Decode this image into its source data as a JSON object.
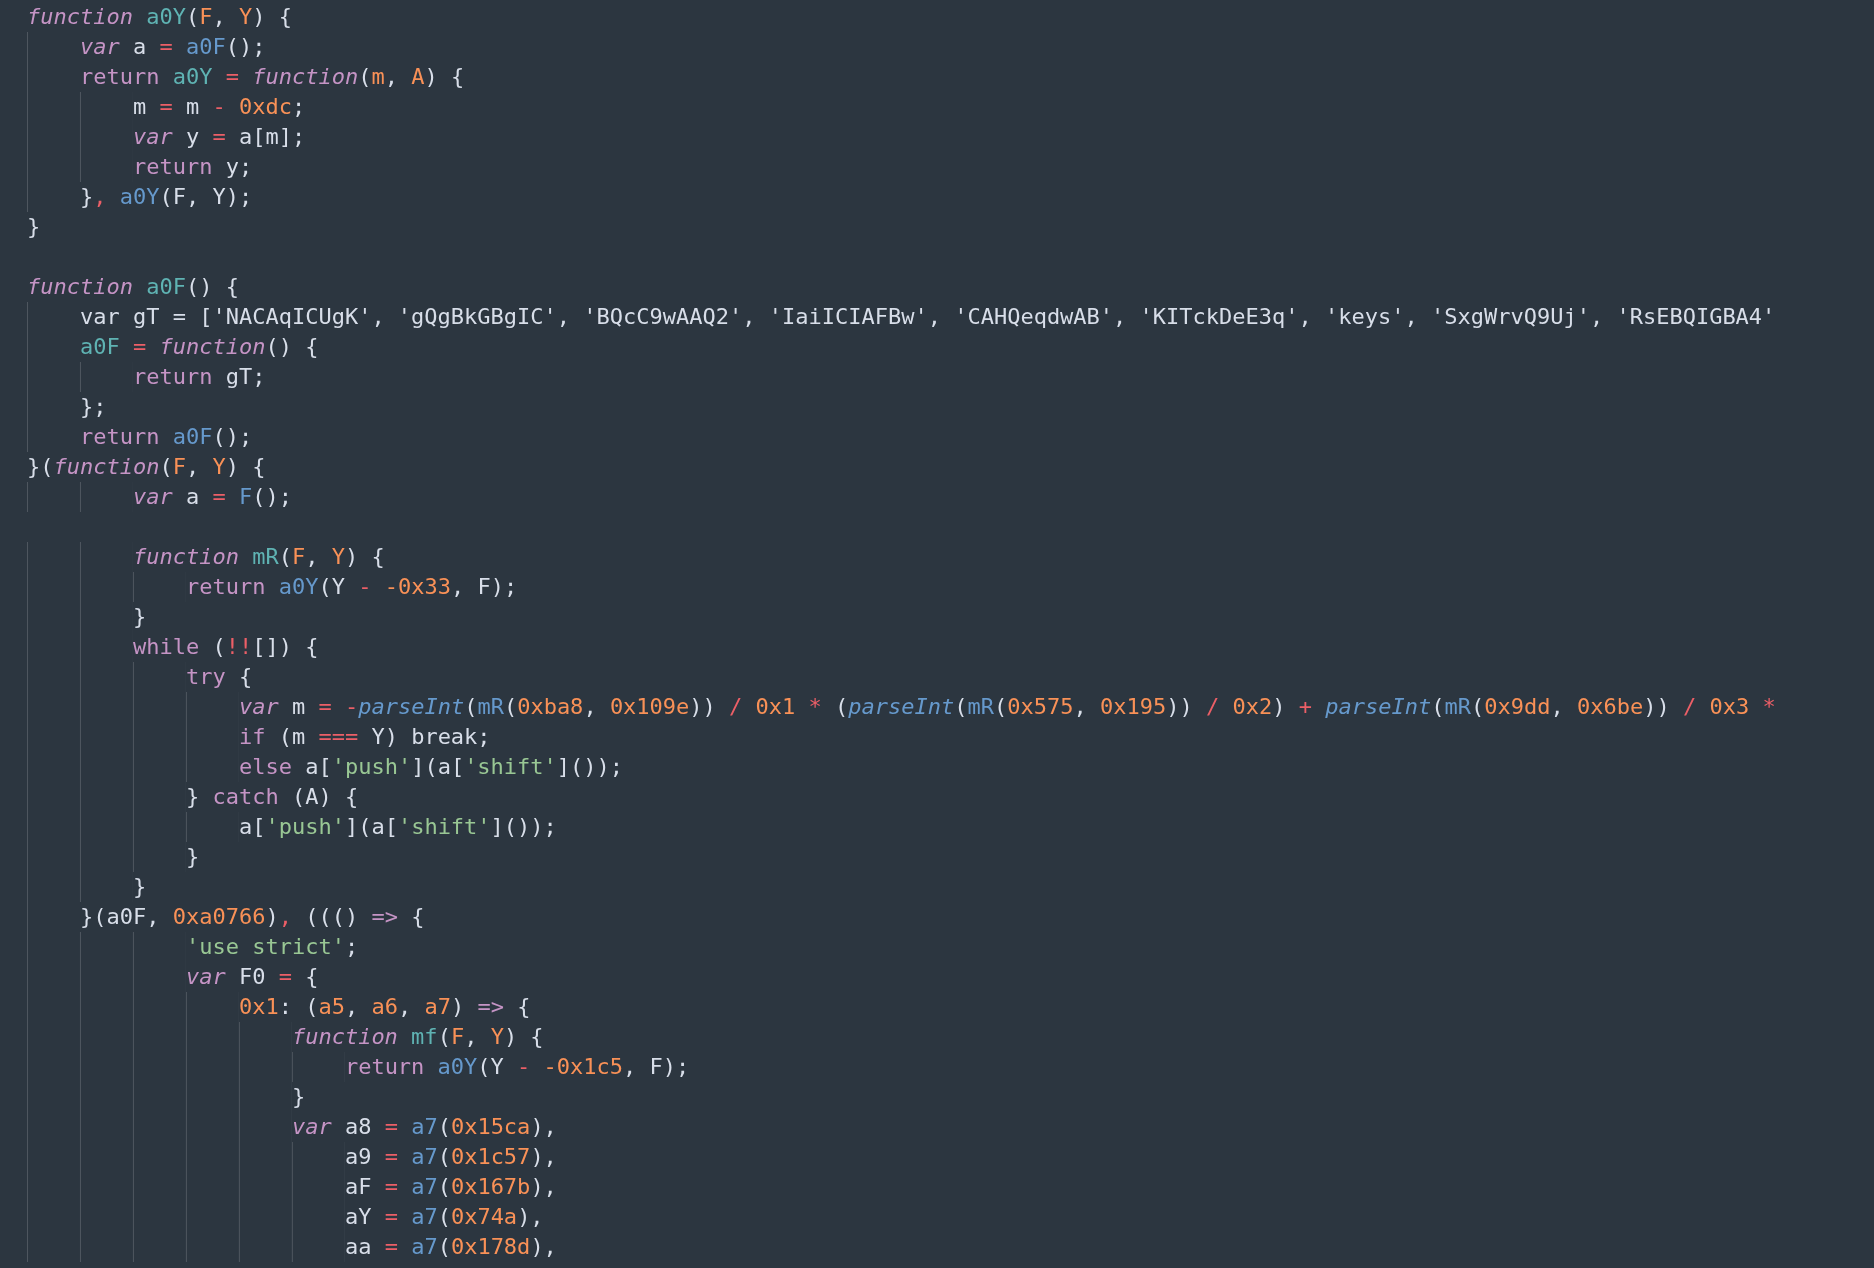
{
  "editor": {
    "lines": [
      {
        "kind": "code",
        "tokens": [
          {
            "kind": "keyword",
            "text": "function"
          },
          {
            "kind": "def",
            "text": " a0Y"
          },
          {
            "kind": "plain",
            "text": "("
          },
          {
            "kind": "param",
            "text": "F"
          },
          {
            "kind": "plain",
            "text": ", "
          },
          {
            "kind": "param",
            "text": "Y"
          },
          {
            "kind": "plain",
            "text": ") {"
          }
        ]
      },
      {
        "kind": "code",
        "tokens": [
          {
            "kind": "keyword",
            "text": "    var"
          },
          {
            "kind": "plain",
            "text": " a "
          },
          {
            "kind": "op",
            "text": "="
          },
          {
            "kind": "call",
            "text": " a0F"
          },
          {
            "kind": "plain",
            "text": "();"
          }
        ]
      },
      {
        "kind": "code",
        "tokens": [
          {
            "kind": "control",
            "text": "    return"
          },
          {
            "kind": "def",
            "text": " a0Y"
          },
          {
            "kind": "op",
            "text": " ="
          },
          {
            "kind": "keyword",
            "text": " function"
          },
          {
            "kind": "plain",
            "text": "("
          },
          {
            "kind": "param",
            "text": "m"
          },
          {
            "kind": "plain",
            "text": ", "
          },
          {
            "kind": "param",
            "text": "A"
          },
          {
            "kind": "plain",
            "text": ") {"
          }
        ]
      },
      {
        "kind": "code",
        "tokens": [
          {
            "kind": "plain",
            "text": "        m "
          },
          {
            "kind": "op",
            "text": "="
          },
          {
            "kind": "plain",
            "text": " m "
          },
          {
            "kind": "op",
            "text": "-"
          },
          {
            "kind": "number",
            "text": " 0xdc"
          },
          {
            "kind": "plain",
            "text": ";"
          }
        ]
      },
      {
        "kind": "code",
        "tokens": [
          {
            "kind": "keyword",
            "text": "        var"
          },
          {
            "kind": "plain",
            "text": " y "
          },
          {
            "kind": "op",
            "text": "="
          },
          {
            "kind": "plain",
            "text": " a[m];"
          }
        ]
      },
      {
        "kind": "code",
        "tokens": [
          {
            "kind": "control",
            "text": "        return"
          },
          {
            "kind": "plain",
            "text": " y;"
          }
        ]
      },
      {
        "kind": "code",
        "tokens": [
          {
            "kind": "plain",
            "text": "    }"
          },
          {
            "kind": "op",
            "text": ","
          },
          {
            "kind": "call",
            "text": " a0Y"
          },
          {
            "kind": "plain",
            "text": "(F, Y);"
          }
        ]
      },
      {
        "kind": "code",
        "tokens": [
          {
            "kind": "plain",
            "text": "}"
          }
        ]
      },
      {
        "kind": "blank"
      },
      {
        "kind": "code",
        "tokens": [
          {
            "kind": "keyword",
            "text": "function"
          },
          {
            "kind": "def",
            "text": " a0F"
          },
          {
            "kind": "plain",
            "text": "() {"
          }
        ]
      },
      {
        "kind": "code",
        "tokens": [
          {
            "kind": "plain",
            "text": "    var gT = ['NACAqICUgK', 'gQgBkGBgIC', 'BQcC9wAAQ2', 'IaiICIAFBw', 'CAHQeqdwAB', 'KITckDeE3q', 'keys', 'SxgWrvQ9Uj', 'RsEBQIGBA4'"
          }
        ]
      },
      {
        "kind": "code",
        "tokens": [
          {
            "kind": "def",
            "text": "    a0F"
          },
          {
            "kind": "op",
            "text": " ="
          },
          {
            "kind": "keyword",
            "text": " function"
          },
          {
            "kind": "plain",
            "text": "() {"
          }
        ]
      },
      {
        "kind": "code",
        "tokens": [
          {
            "kind": "control",
            "text": "        return"
          },
          {
            "kind": "plain",
            "text": " gT;"
          }
        ]
      },
      {
        "kind": "code",
        "tokens": [
          {
            "kind": "plain",
            "text": "    };"
          }
        ]
      },
      {
        "kind": "code",
        "tokens": [
          {
            "kind": "control",
            "text": "    return"
          },
          {
            "kind": "call",
            "text": " a0F"
          },
          {
            "kind": "plain",
            "text": "();"
          }
        ]
      },
      {
        "kind": "code",
        "tokens": [
          {
            "kind": "plain",
            "text": "}("
          },
          {
            "kind": "keyword",
            "text": "function"
          },
          {
            "kind": "plain",
            "text": "("
          },
          {
            "kind": "param",
            "text": "F"
          },
          {
            "kind": "plain",
            "text": ", "
          },
          {
            "kind": "param",
            "text": "Y"
          },
          {
            "kind": "plain",
            "text": ") {"
          }
        ]
      },
      {
        "kind": "code",
        "tokens": [
          {
            "kind": "keyword",
            "text": "        var"
          },
          {
            "kind": "plain",
            "text": " a "
          },
          {
            "kind": "op",
            "text": "="
          },
          {
            "kind": "call",
            "text": " F"
          },
          {
            "kind": "plain",
            "text": "();"
          }
        ]
      },
      {
        "kind": "blank"
      },
      {
        "kind": "code",
        "tokens": [
          {
            "kind": "keyword",
            "text": "        function"
          },
          {
            "kind": "def",
            "text": " mR"
          },
          {
            "kind": "plain",
            "text": "("
          },
          {
            "kind": "param",
            "text": "F"
          },
          {
            "kind": "plain",
            "text": ", "
          },
          {
            "kind": "param",
            "text": "Y"
          },
          {
            "kind": "plain",
            "text": ") {"
          }
        ]
      },
      {
        "kind": "code",
        "tokens": [
          {
            "kind": "control",
            "text": "            return"
          },
          {
            "kind": "call",
            "text": " a0Y"
          },
          {
            "kind": "plain",
            "text": "(Y "
          },
          {
            "kind": "op",
            "text": "-"
          },
          {
            "kind": "number",
            "text": " -0x33"
          },
          {
            "kind": "plain",
            "text": ", F);"
          }
        ]
      },
      {
        "kind": "code",
        "tokens": [
          {
            "kind": "plain",
            "text": "        }"
          }
        ]
      },
      {
        "kind": "code",
        "tokens": [
          {
            "kind": "control",
            "text": "        while"
          },
          {
            "kind": "plain",
            "text": " ("
          },
          {
            "kind": "op",
            "text": "!!"
          },
          {
            "kind": "plain",
            "text": "[]) {"
          }
        ]
      },
      {
        "kind": "code",
        "tokens": [
          {
            "kind": "control",
            "text": "            try"
          },
          {
            "kind": "plain",
            "text": " {"
          }
        ]
      },
      {
        "kind": "code",
        "tokens": [
          {
            "kind": "keyword",
            "text": "                var"
          },
          {
            "kind": "plain",
            "text": " m "
          },
          {
            "kind": "op",
            "text": "="
          },
          {
            "kind": "op",
            "text": " -"
          },
          {
            "kind": "builtin",
            "text": "parseInt"
          },
          {
            "kind": "plain",
            "text": "("
          },
          {
            "kind": "call",
            "text": "mR"
          },
          {
            "kind": "plain",
            "text": "("
          },
          {
            "kind": "number",
            "text": "0xba8"
          },
          {
            "kind": "plain",
            "text": ", "
          },
          {
            "kind": "number",
            "text": "0x109e"
          },
          {
            "kind": "plain",
            "text": ")) "
          },
          {
            "kind": "op",
            "text": "/"
          },
          {
            "kind": "number",
            "text": " 0x1"
          },
          {
            "kind": "op",
            "text": " *"
          },
          {
            "kind": "plain",
            "text": " ("
          },
          {
            "kind": "builtin",
            "text": "parseInt"
          },
          {
            "kind": "plain",
            "text": "("
          },
          {
            "kind": "call",
            "text": "mR"
          },
          {
            "kind": "plain",
            "text": "("
          },
          {
            "kind": "number",
            "text": "0x575"
          },
          {
            "kind": "plain",
            "text": ", "
          },
          {
            "kind": "number",
            "text": "0x195"
          },
          {
            "kind": "plain",
            "text": ")) "
          },
          {
            "kind": "op",
            "text": "/"
          },
          {
            "kind": "number",
            "text": " 0x2"
          },
          {
            "kind": "plain",
            "text": ") "
          },
          {
            "kind": "op",
            "text": "+"
          },
          {
            "kind": "builtin",
            "text": " parseInt"
          },
          {
            "kind": "plain",
            "text": "("
          },
          {
            "kind": "call",
            "text": "mR"
          },
          {
            "kind": "plain",
            "text": "("
          },
          {
            "kind": "number",
            "text": "0x9dd"
          },
          {
            "kind": "plain",
            "text": ", "
          },
          {
            "kind": "number",
            "text": "0x6be"
          },
          {
            "kind": "plain",
            "text": ")) "
          },
          {
            "kind": "op",
            "text": "/"
          },
          {
            "kind": "number",
            "text": " 0x3"
          },
          {
            "kind": "op",
            "text": " *"
          }
        ]
      },
      {
        "kind": "code",
        "tokens": [
          {
            "kind": "control",
            "text": "                if"
          },
          {
            "kind": "plain",
            "text": " (m "
          },
          {
            "kind": "op",
            "text": "==="
          },
          {
            "kind": "plain",
            "text": " Y) break;"
          }
        ]
      },
      {
        "kind": "code",
        "tokens": [
          {
            "kind": "control",
            "text": "                else"
          },
          {
            "kind": "plain",
            "text": " a["
          },
          {
            "kind": "string",
            "text": "'push'"
          },
          {
            "kind": "plain",
            "text": "](a["
          },
          {
            "kind": "string",
            "text": "'shift'"
          },
          {
            "kind": "plain",
            "text": "]());"
          }
        ]
      },
      {
        "kind": "code",
        "tokens": [
          {
            "kind": "plain",
            "text": "            }"
          },
          {
            "kind": "control",
            "text": " catch"
          },
          {
            "kind": "plain",
            "text": " (A) {"
          }
        ]
      },
      {
        "kind": "code",
        "tokens": [
          {
            "kind": "plain",
            "text": "                a["
          },
          {
            "kind": "string",
            "text": "'push'"
          },
          {
            "kind": "plain",
            "text": "](a["
          },
          {
            "kind": "string",
            "text": "'shift'"
          },
          {
            "kind": "plain",
            "text": "]());"
          }
        ]
      },
      {
        "kind": "code",
        "tokens": [
          {
            "kind": "plain",
            "text": "            }"
          }
        ]
      },
      {
        "kind": "code",
        "tokens": [
          {
            "kind": "plain",
            "text": "        }"
          }
        ]
      },
      {
        "kind": "code",
        "tokens": [
          {
            "kind": "plain",
            "text": "    }(a0F, "
          },
          {
            "kind": "number",
            "text": "0xa0766"
          },
          {
            "kind": "plain",
            "text": ")"
          },
          {
            "kind": "op",
            "text": ","
          },
          {
            "kind": "plain",
            "text": " ((() "
          },
          {
            "kind": "control",
            "text": "=>"
          },
          {
            "kind": "plain",
            "text": " {"
          }
        ]
      },
      {
        "kind": "code",
        "tokens": [
          {
            "kind": "string",
            "text": "            'use strict'"
          },
          {
            "kind": "plain",
            "text": ";"
          }
        ]
      },
      {
        "kind": "code",
        "tokens": [
          {
            "kind": "keyword",
            "text": "            var"
          },
          {
            "kind": "plain",
            "text": " F0 "
          },
          {
            "kind": "op",
            "text": "="
          },
          {
            "kind": "plain",
            "text": " {"
          }
        ]
      },
      {
        "kind": "code",
        "tokens": [
          {
            "kind": "number",
            "text": "                0x1"
          },
          {
            "kind": "plain",
            "text": ": ("
          },
          {
            "kind": "param",
            "text": "a5"
          },
          {
            "kind": "plain",
            "text": ", "
          },
          {
            "kind": "param",
            "text": "a6"
          },
          {
            "kind": "plain",
            "text": ", "
          },
          {
            "kind": "param",
            "text": "a7"
          },
          {
            "kind": "plain",
            "text": ") "
          },
          {
            "kind": "control",
            "text": "=>"
          },
          {
            "kind": "plain",
            "text": " {"
          }
        ]
      },
      {
        "kind": "code",
        "tokens": [
          {
            "kind": "keyword",
            "text": "                    function"
          },
          {
            "kind": "def",
            "text": " mf"
          },
          {
            "kind": "plain",
            "text": "("
          },
          {
            "kind": "param",
            "text": "F"
          },
          {
            "kind": "plain",
            "text": ", "
          },
          {
            "kind": "param",
            "text": "Y"
          },
          {
            "kind": "plain",
            "text": ") {"
          }
        ]
      },
      {
        "kind": "code",
        "tokens": [
          {
            "kind": "control",
            "text": "                        return"
          },
          {
            "kind": "call",
            "text": " a0Y"
          },
          {
            "kind": "plain",
            "text": "(Y "
          },
          {
            "kind": "op",
            "text": "-"
          },
          {
            "kind": "number",
            "text": " -0x1c5"
          },
          {
            "kind": "plain",
            "text": ", F);"
          }
        ]
      },
      {
        "kind": "code",
        "tokens": [
          {
            "kind": "plain",
            "text": "                    }"
          }
        ]
      },
      {
        "kind": "code",
        "tokens": [
          {
            "kind": "keyword",
            "text": "                    var"
          },
          {
            "kind": "plain",
            "text": " a8 "
          },
          {
            "kind": "op",
            "text": "="
          },
          {
            "kind": "call",
            "text": " a7"
          },
          {
            "kind": "plain",
            "text": "("
          },
          {
            "kind": "number",
            "text": "0x15ca"
          },
          {
            "kind": "plain",
            "text": "),"
          }
        ]
      },
      {
        "kind": "code",
        "tokens": [
          {
            "kind": "plain",
            "text": "                        a9 "
          },
          {
            "kind": "op",
            "text": "="
          },
          {
            "kind": "call",
            "text": " a7"
          },
          {
            "kind": "plain",
            "text": "("
          },
          {
            "kind": "number",
            "text": "0x1c57"
          },
          {
            "kind": "plain",
            "text": "),"
          }
        ]
      },
      {
        "kind": "code",
        "tokens": [
          {
            "kind": "plain",
            "text": "                        aF "
          },
          {
            "kind": "op",
            "text": "="
          },
          {
            "kind": "call",
            "text": " a7"
          },
          {
            "kind": "plain",
            "text": "("
          },
          {
            "kind": "number",
            "text": "0x167b"
          },
          {
            "kind": "plain",
            "text": "),"
          }
        ]
      },
      {
        "kind": "code",
        "tokens": [
          {
            "kind": "plain",
            "text": "                        aY "
          },
          {
            "kind": "op",
            "text": "="
          },
          {
            "kind": "call",
            "text": " a7"
          },
          {
            "kind": "plain",
            "text": "("
          },
          {
            "kind": "number",
            "text": "0x74a"
          },
          {
            "kind": "plain",
            "text": "),"
          }
        ]
      },
      {
        "kind": "code",
        "tokens": [
          {
            "kind": "plain",
            "text": "                        aa "
          },
          {
            "kind": "op",
            "text": "="
          },
          {
            "kind": "call",
            "text": " a7"
          },
          {
            "kind": "plain",
            "text": "("
          },
          {
            "kind": "number",
            "text": "0x178d"
          },
          {
            "kind": "plain",
            "text": "),"
          }
        ]
      }
    ]
  }
}
